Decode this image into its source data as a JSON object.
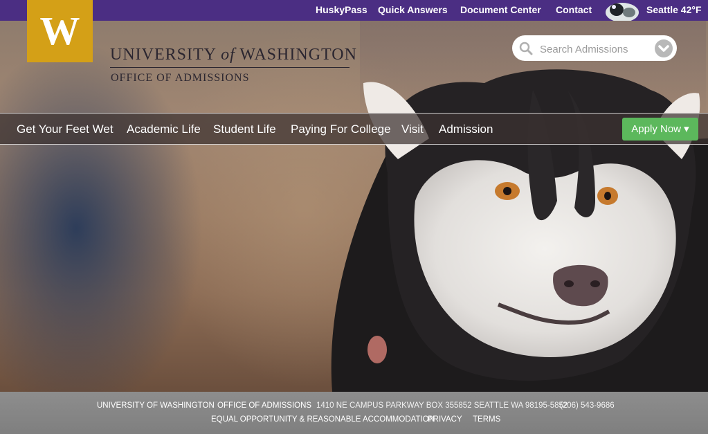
{
  "top_links": [
    "HuskyPass",
    "Quick Answers",
    "Document Center",
    "Contact"
  ],
  "weather": {
    "label": "Seattle 42°F"
  },
  "logo": {
    "letter": "W",
    "university": "UNIVERSITY",
    "of": "of",
    "washington": "WASHINGTON",
    "office": "OFFICE OF ADMISSIONS"
  },
  "search": {
    "placeholder": "Search Admissions"
  },
  "nav": {
    "items": [
      "Get Your Feet Wet",
      "Academic Life",
      "Student Life",
      "Paying For College",
      "Visit",
      "Admission"
    ],
    "apply_label": "Apply Now ▾"
  },
  "footer": {
    "row1": {
      "uw_link": "UNIVERSITY OF WASHINGTON",
      "office_link": "OFFICE OF ADMISSIONS",
      "address": "1410 NE CAMPUS PARKWAY BOX 355852 SEATTLE WA 98195-5852",
      "phone": "(206) 543-9686"
    },
    "row2": {
      "eo_link": "EQUAL OPPORTUNITY & REASONABLE ACCOMMODATION",
      "privacy_link": "PRIVACY",
      "terms_link": "TERMS"
    }
  },
  "colors": {
    "purple": "#4b2e83",
    "gold": "#d4a017",
    "apply_green": "#5cb85c"
  }
}
